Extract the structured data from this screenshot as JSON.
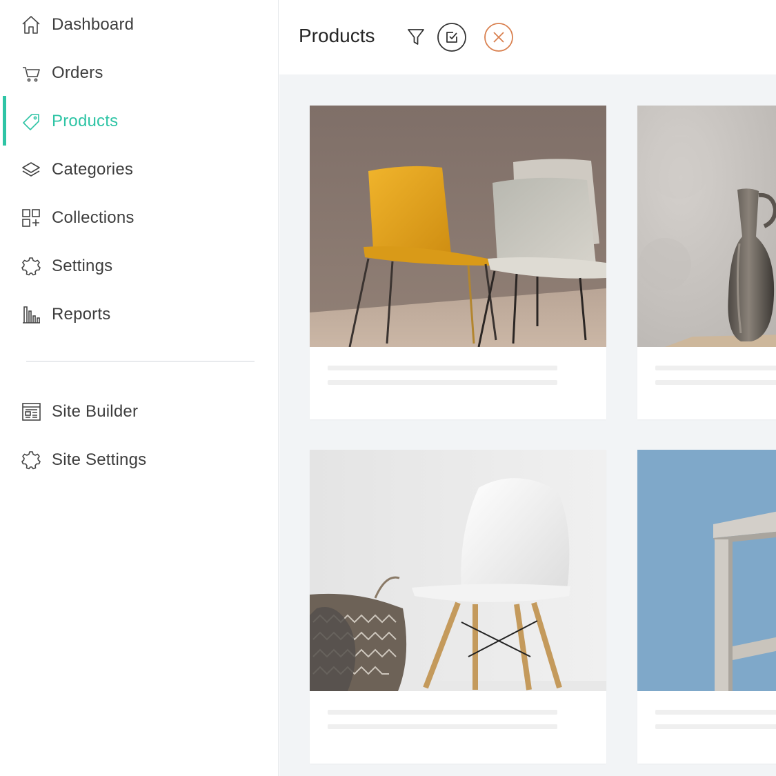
{
  "sidebar": {
    "items": [
      {
        "label": "Dashboard",
        "icon": "home-icon"
      },
      {
        "label": "Orders",
        "icon": "cart-icon"
      },
      {
        "label": "Products",
        "icon": "tag-icon",
        "active": true
      },
      {
        "label": "Categories",
        "icon": "layers-icon"
      },
      {
        "label": "Collections",
        "icon": "grid-plus-icon"
      },
      {
        "label": "Settings",
        "icon": "gear-icon"
      },
      {
        "label": "Reports",
        "icon": "bar-chart-icon"
      }
    ],
    "secondary_items": [
      {
        "label": "Site Builder",
        "icon": "site-builder-icon"
      },
      {
        "label": "Site Settings",
        "icon": "gear-icon"
      }
    ]
  },
  "header": {
    "title": "Products",
    "actions": [
      "filter-icon",
      "edit-icon",
      "close-icon"
    ]
  },
  "products": [
    {
      "image": "chairs-yellow-grey-image"
    },
    {
      "image": "vase-image"
    },
    {
      "image": "white-chair-basket-image"
    },
    {
      "image": "stool-blue-wall-image"
    }
  ],
  "colors": {
    "accent": "#2ec4a5",
    "close_accent": "#d9804f",
    "background": "#f2f4f6"
  }
}
